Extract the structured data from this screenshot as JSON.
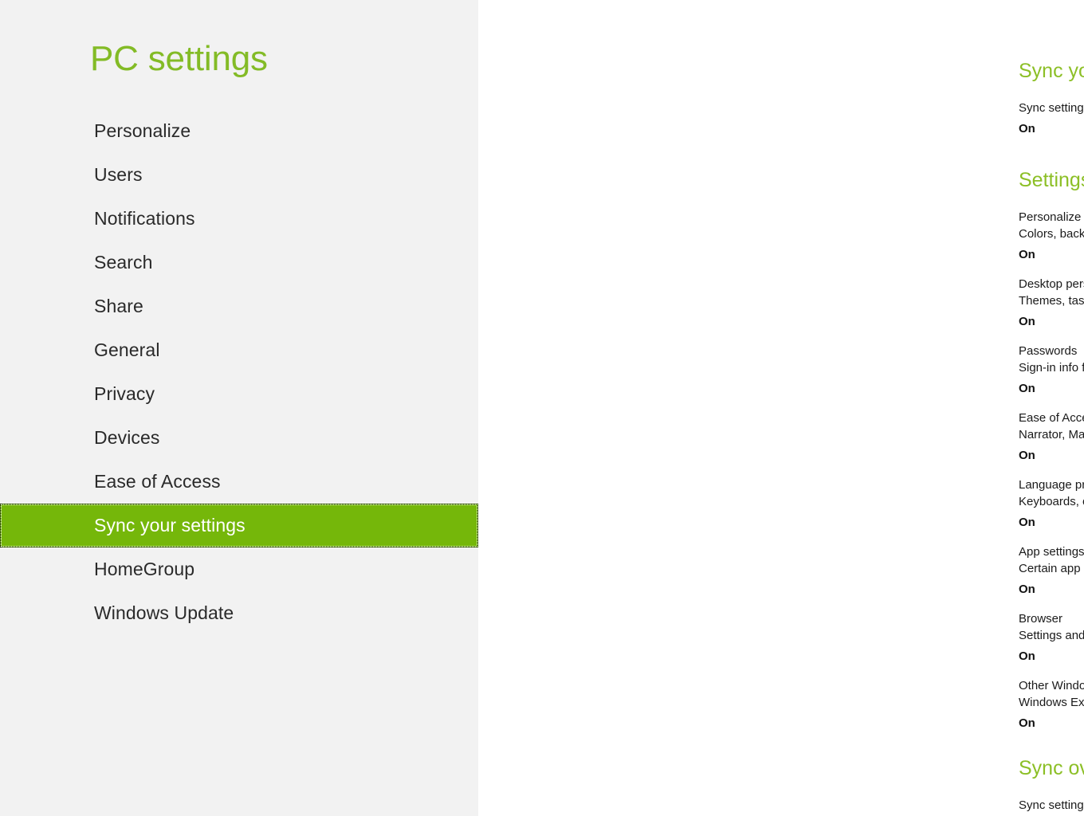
{
  "app": {
    "title": "PC settings",
    "accent_green": "#75b70a",
    "heading_green": "#8cbf26",
    "sidebar_bg": "#f2f2f2",
    "content_bg": "#ffffff",
    "toggle_on_color": "#76b900",
    "toggle_border_color": "#a6a6a6",
    "toggle_thumb_color": "#000000"
  },
  "sidebar": {
    "title": "PC settings",
    "items": [
      {
        "label": "Personalize",
        "selected": false
      },
      {
        "label": "Users",
        "selected": false
      },
      {
        "label": "Notifications",
        "selected": false
      },
      {
        "label": "Search",
        "selected": false
      },
      {
        "label": "Share",
        "selected": false
      },
      {
        "label": "General",
        "selected": false
      },
      {
        "label": "Privacy",
        "selected": false
      },
      {
        "label": "Devices",
        "selected": false
      },
      {
        "label": "Ease of Access",
        "selected": false
      },
      {
        "label": "Sync your settings",
        "selected": true
      },
      {
        "label": "HomeGroup",
        "selected": false
      },
      {
        "label": "Windows Update",
        "selected": false
      }
    ]
  },
  "content": {
    "sync_your_settings": {
      "heading": "Sync your settings",
      "setting": {
        "title": "Sync settings on this PC",
        "state": "On"
      }
    },
    "settings_to_sync": {
      "heading": "Settings to sync",
      "items": [
        {
          "title": "Personalize",
          "description": "Colors, background, lock screen, and your account picture",
          "state": "On"
        },
        {
          "title": "Desktop personalization",
          "description": "Themes, taskbar, high contrast, and more",
          "state": "On"
        },
        {
          "title": "Passwords",
          "description": "Sign-in info for some apps, websites, networks, and HomeGroup",
          "state": "On"
        },
        {
          "title": "Ease of Access",
          "description": "Narrator, Magnifier, and more",
          "state": "On"
        },
        {
          "title": "Language preferences",
          "description": "Keyboards, other input methods, display language, and more",
          "state": "On"
        },
        {
          "title": "App settings",
          "description": "Certain app settings and purchases made in an app",
          "state": "On"
        },
        {
          "title": "Browser",
          "description": "Settings and info like history and favorites",
          "state": "On"
        },
        {
          "title": "Other Windows settings",
          "description": "Windows Explorer, mouse, and more",
          "state": "On"
        }
      ]
    },
    "sync_over_metered": {
      "heading": "Sync over metered connections",
      "setting": {
        "title": "Sync settings over metered connections"
      }
    }
  }
}
